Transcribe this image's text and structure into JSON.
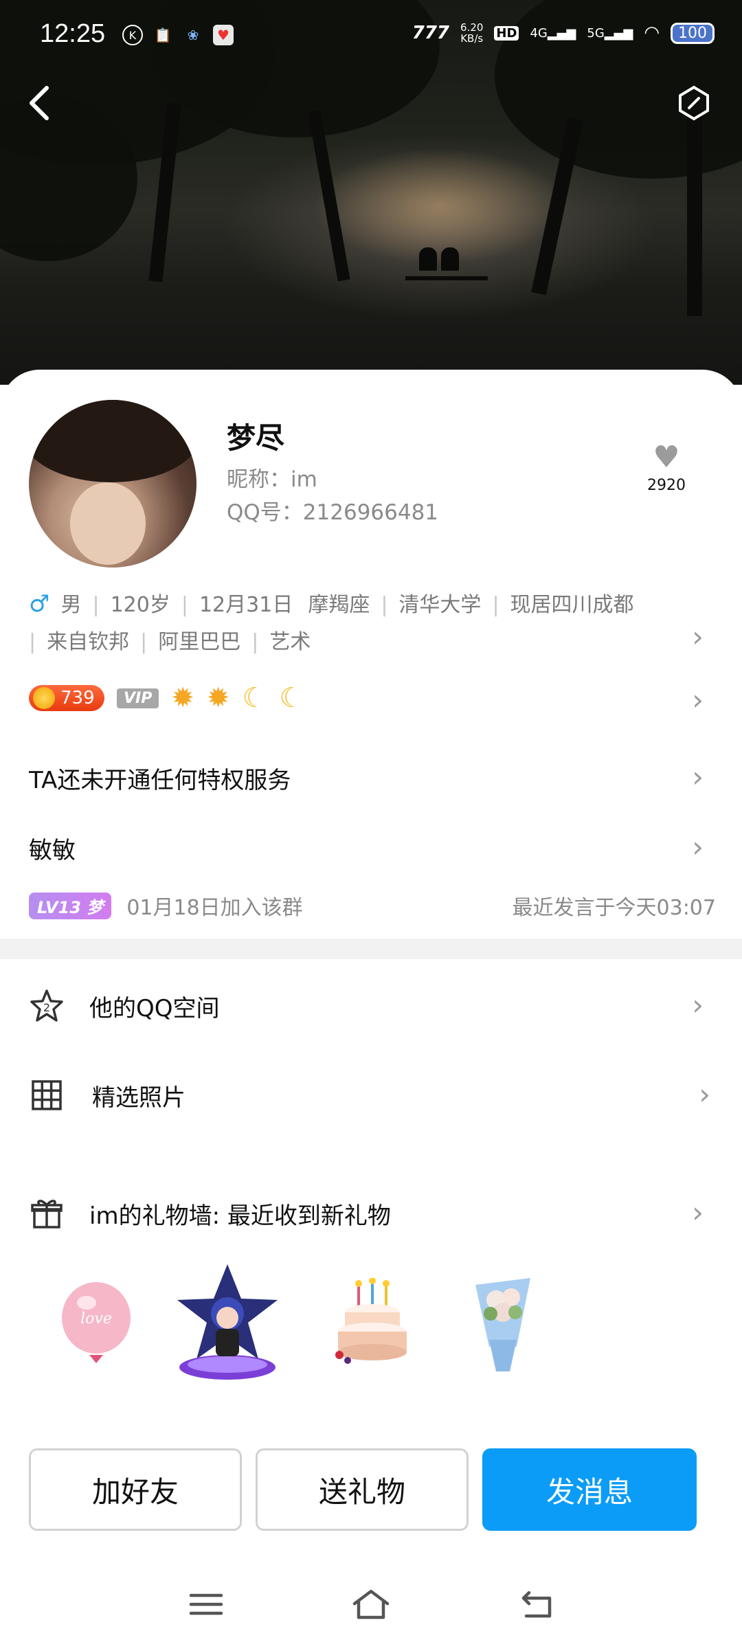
{
  "status_bar": {
    "time": "12:25",
    "net_speed_value": "6.20",
    "net_speed_unit": "KB/s",
    "hd": "HD",
    "sim1": "4G",
    "sim2": "5G",
    "battery": "100"
  },
  "profile": {
    "name": "梦尽",
    "nickname": "昵称：im",
    "qq": "QQ号：2126966481",
    "likes": "2920",
    "tags_line1": [
      "男",
      "120岁",
      "12月31日",
      "摩羯座",
      "清华大学",
      "现居四川成都"
    ],
    "tags_line2": [
      "来自钦邦",
      "阿里巴巴",
      "艺术"
    ],
    "sun_level": "739",
    "vip": "VIP"
  },
  "privilege_text": "TA还未开通任何特权服务",
  "group": {
    "name": "敏敏",
    "level_badge": "LV13 梦",
    "joined": "01月18日加入该群",
    "last_spoke": "最近发言于今天03:07"
  },
  "rows": {
    "qzone": "他的QQ空间",
    "photos": "精选照片",
    "gift_wall": "im的礼物墙: 最近收到新礼物"
  },
  "gifts": [
    {
      "name": "love-balloon",
      "text": "love"
    },
    {
      "name": "anime-figure"
    },
    {
      "name": "birthday-cake"
    },
    {
      "name": "flower-bouquet"
    }
  ],
  "buttons": {
    "add_friend": "加好友",
    "send_gift": "送礼物",
    "send_message": "发消息"
  },
  "colors": {
    "primary": "#0b9cf8",
    "male": "#2aa0e6"
  }
}
